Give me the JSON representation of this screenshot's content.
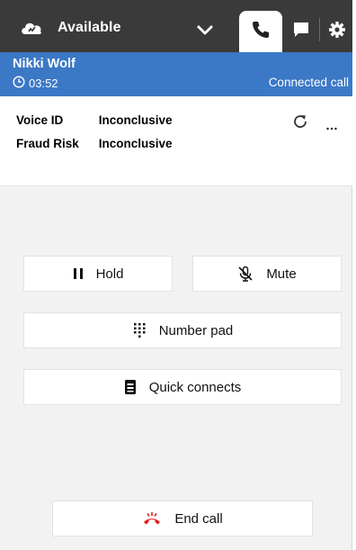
{
  "topbar": {
    "status_label": "Available",
    "status_icon": "cloud-phone-icon",
    "tabs": [
      "phone-icon",
      "chat-icon",
      "gear-icon"
    ],
    "colors": {
      "bar": "#3a3a3a",
      "header": "#3b78c6",
      "end_call_red": "#e02020"
    }
  },
  "call": {
    "caller_name": "Nikki Wolf",
    "timer": "03:52",
    "status": "Connected call"
  },
  "info": {
    "voice_id_label": "Voice ID",
    "voice_id_value": "Inconclusive",
    "fraud_risk_label": "Fraud Risk",
    "fraud_risk_value": "Inconclusive",
    "more_label": "…"
  },
  "controls": {
    "hold": "Hold",
    "mute": "Mute",
    "number_pad": "Number pad",
    "quick_connects": "Quick connects",
    "end_call": "End call"
  }
}
